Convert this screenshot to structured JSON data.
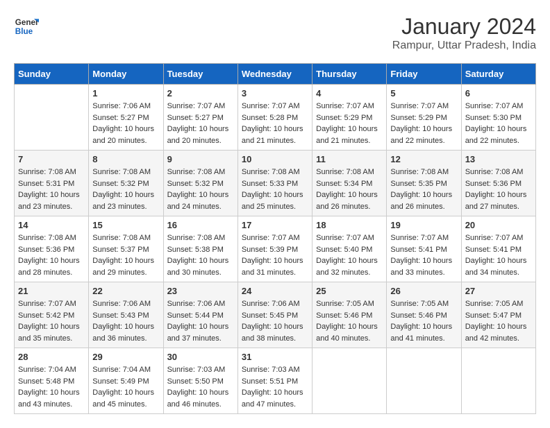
{
  "header": {
    "logo_general": "General",
    "logo_blue": "Blue",
    "title": "January 2024",
    "location": "Rampur, Uttar Pradesh, India"
  },
  "days_of_week": [
    "Sunday",
    "Monday",
    "Tuesday",
    "Wednesday",
    "Thursday",
    "Friday",
    "Saturday"
  ],
  "weeks": [
    [
      {
        "num": "",
        "info": ""
      },
      {
        "num": "1",
        "info": "Sunrise: 7:06 AM\nSunset: 5:27 PM\nDaylight: 10 hours\nand 20 minutes."
      },
      {
        "num": "2",
        "info": "Sunrise: 7:07 AM\nSunset: 5:27 PM\nDaylight: 10 hours\nand 20 minutes."
      },
      {
        "num": "3",
        "info": "Sunrise: 7:07 AM\nSunset: 5:28 PM\nDaylight: 10 hours\nand 21 minutes."
      },
      {
        "num": "4",
        "info": "Sunrise: 7:07 AM\nSunset: 5:29 PM\nDaylight: 10 hours\nand 21 minutes."
      },
      {
        "num": "5",
        "info": "Sunrise: 7:07 AM\nSunset: 5:29 PM\nDaylight: 10 hours\nand 22 minutes."
      },
      {
        "num": "6",
        "info": "Sunrise: 7:07 AM\nSunset: 5:30 PM\nDaylight: 10 hours\nand 22 minutes."
      }
    ],
    [
      {
        "num": "7",
        "info": "Sunrise: 7:08 AM\nSunset: 5:31 PM\nDaylight: 10 hours\nand 23 minutes."
      },
      {
        "num": "8",
        "info": "Sunrise: 7:08 AM\nSunset: 5:32 PM\nDaylight: 10 hours\nand 23 minutes."
      },
      {
        "num": "9",
        "info": "Sunrise: 7:08 AM\nSunset: 5:32 PM\nDaylight: 10 hours\nand 24 minutes."
      },
      {
        "num": "10",
        "info": "Sunrise: 7:08 AM\nSunset: 5:33 PM\nDaylight: 10 hours\nand 25 minutes."
      },
      {
        "num": "11",
        "info": "Sunrise: 7:08 AM\nSunset: 5:34 PM\nDaylight: 10 hours\nand 26 minutes."
      },
      {
        "num": "12",
        "info": "Sunrise: 7:08 AM\nSunset: 5:35 PM\nDaylight: 10 hours\nand 26 minutes."
      },
      {
        "num": "13",
        "info": "Sunrise: 7:08 AM\nSunset: 5:36 PM\nDaylight: 10 hours\nand 27 minutes."
      }
    ],
    [
      {
        "num": "14",
        "info": "Sunrise: 7:08 AM\nSunset: 5:36 PM\nDaylight: 10 hours\nand 28 minutes."
      },
      {
        "num": "15",
        "info": "Sunrise: 7:08 AM\nSunset: 5:37 PM\nDaylight: 10 hours\nand 29 minutes."
      },
      {
        "num": "16",
        "info": "Sunrise: 7:08 AM\nSunset: 5:38 PM\nDaylight: 10 hours\nand 30 minutes."
      },
      {
        "num": "17",
        "info": "Sunrise: 7:07 AM\nSunset: 5:39 PM\nDaylight: 10 hours\nand 31 minutes."
      },
      {
        "num": "18",
        "info": "Sunrise: 7:07 AM\nSunset: 5:40 PM\nDaylight: 10 hours\nand 32 minutes."
      },
      {
        "num": "19",
        "info": "Sunrise: 7:07 AM\nSunset: 5:41 PM\nDaylight: 10 hours\nand 33 minutes."
      },
      {
        "num": "20",
        "info": "Sunrise: 7:07 AM\nSunset: 5:41 PM\nDaylight: 10 hours\nand 34 minutes."
      }
    ],
    [
      {
        "num": "21",
        "info": "Sunrise: 7:07 AM\nSunset: 5:42 PM\nDaylight: 10 hours\nand 35 minutes."
      },
      {
        "num": "22",
        "info": "Sunrise: 7:06 AM\nSunset: 5:43 PM\nDaylight: 10 hours\nand 36 minutes."
      },
      {
        "num": "23",
        "info": "Sunrise: 7:06 AM\nSunset: 5:44 PM\nDaylight: 10 hours\nand 37 minutes."
      },
      {
        "num": "24",
        "info": "Sunrise: 7:06 AM\nSunset: 5:45 PM\nDaylight: 10 hours\nand 38 minutes."
      },
      {
        "num": "25",
        "info": "Sunrise: 7:05 AM\nSunset: 5:46 PM\nDaylight: 10 hours\nand 40 minutes."
      },
      {
        "num": "26",
        "info": "Sunrise: 7:05 AM\nSunset: 5:46 PM\nDaylight: 10 hours\nand 41 minutes."
      },
      {
        "num": "27",
        "info": "Sunrise: 7:05 AM\nSunset: 5:47 PM\nDaylight: 10 hours\nand 42 minutes."
      }
    ],
    [
      {
        "num": "28",
        "info": "Sunrise: 7:04 AM\nSunset: 5:48 PM\nDaylight: 10 hours\nand 43 minutes."
      },
      {
        "num": "29",
        "info": "Sunrise: 7:04 AM\nSunset: 5:49 PM\nDaylight: 10 hours\nand 45 minutes."
      },
      {
        "num": "30",
        "info": "Sunrise: 7:03 AM\nSunset: 5:50 PM\nDaylight: 10 hours\nand 46 minutes."
      },
      {
        "num": "31",
        "info": "Sunrise: 7:03 AM\nSunset: 5:51 PM\nDaylight: 10 hours\nand 47 minutes."
      },
      {
        "num": "",
        "info": ""
      },
      {
        "num": "",
        "info": ""
      },
      {
        "num": "",
        "info": ""
      }
    ]
  ]
}
